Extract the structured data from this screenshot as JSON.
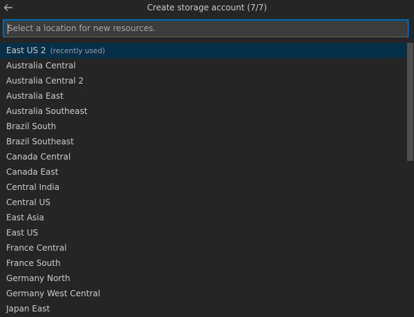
{
  "quick_pick": {
    "title": "Create storage account (7/7)",
    "back_icon": "arrow-left-icon",
    "input": {
      "value": "",
      "placeholder": "Select a location for new resources."
    },
    "items": [
      {
        "label": "East US 2",
        "description": "(recently used)"
      },
      {
        "label": "Australia Central"
      },
      {
        "label": "Australia Central 2"
      },
      {
        "label": "Australia East"
      },
      {
        "label": "Australia Southeast"
      },
      {
        "label": "Brazil South"
      },
      {
        "label": "Brazil Southeast"
      },
      {
        "label": "Canada Central"
      },
      {
        "label": "Canada East"
      },
      {
        "label": "Central India"
      },
      {
        "label": "Central US"
      },
      {
        "label": "East Asia"
      },
      {
        "label": "East US"
      },
      {
        "label": "France Central"
      },
      {
        "label": "France South"
      },
      {
        "label": "Germany North"
      },
      {
        "label": "Germany West Central"
      },
      {
        "label": "Japan East"
      }
    ],
    "selected_index": 0
  },
  "colors": {
    "background": "#252526",
    "input_border": "#007fd4",
    "selected_row": "#062f4a",
    "text": "#cccccc",
    "description": "#9d9d9d"
  }
}
